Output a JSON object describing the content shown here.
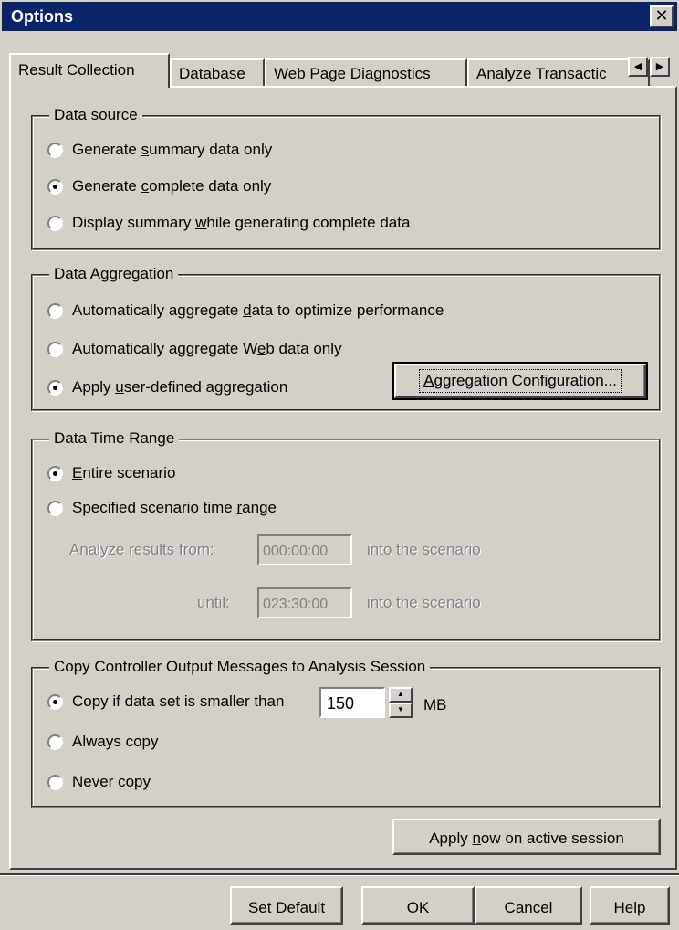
{
  "window": {
    "title": "Options",
    "close_glyph": "✕"
  },
  "tabs": [
    {
      "label": "Result Collection",
      "active": true
    },
    {
      "label": "Database",
      "active": false
    },
    {
      "label": "Web Page Diagnostics",
      "active": false
    },
    {
      "label": "Analyze Transactic",
      "active": false
    }
  ],
  "tab_scroll": {
    "left_glyph": "◀",
    "right_glyph": "▶"
  },
  "data_source": {
    "legend": "Data source",
    "options": [
      {
        "pre": "Generate ",
        "u": "s",
        "post": "ummary data only",
        "checked": false
      },
      {
        "pre": "Generate ",
        "u": "c",
        "post": "omplete data only",
        "checked": true
      },
      {
        "pre": "Display summary ",
        "u": "w",
        "post": "hile generating complete data",
        "checked": false
      }
    ]
  },
  "data_aggregation": {
    "legend": "Data Aggregation",
    "options": [
      {
        "pre": "Automatically aggregate ",
        "u": "d",
        "post": "ata to optimize performance",
        "checked": false
      },
      {
        "pre": "Automatically aggregate W",
        "u": "e",
        "post": "b data only",
        "checked": false
      },
      {
        "pre": "Apply ",
        "u": "u",
        "post": "ser-defined aggregation",
        "checked": true
      }
    ],
    "config_button": {
      "u": "A",
      "post": "ggregation Configuration..."
    }
  },
  "time_range": {
    "legend": "Data Time Range",
    "options": [
      {
        "pre": "",
        "u": "E",
        "post": "ntire scenario",
        "checked": true
      },
      {
        "pre": "Specified scenario time ",
        "u": "r",
        "post": "ange",
        "checked": false
      }
    ],
    "from_label": "Analyze results from:",
    "from_value": "000:00:00",
    "from_suffix": "into the scenario",
    "until_label": "until:",
    "until_value": "023:30:00",
    "until_suffix": "into the scenario"
  },
  "copy_messages": {
    "legend": "Copy Controller Output Messages to Analysis Session",
    "options": [
      {
        "label": "Copy if data set is smaller than",
        "checked": true
      },
      {
        "label": "Always copy",
        "checked": false
      },
      {
        "label": "Never copy",
        "checked": false
      }
    ],
    "size_value": "150",
    "size_unit": "MB",
    "spin_up": "▲",
    "spin_down": "▼"
  },
  "apply_button": {
    "pre": "Apply ",
    "u": "n",
    "post": "ow on active session"
  },
  "footer": {
    "set_default": {
      "u": "S",
      "post": "et Default"
    },
    "ok": {
      "u": "O",
      "post": "K"
    },
    "cancel": {
      "u": "C",
      "post": "ancel"
    },
    "help": {
      "u": "H",
      "post": "elp"
    }
  }
}
